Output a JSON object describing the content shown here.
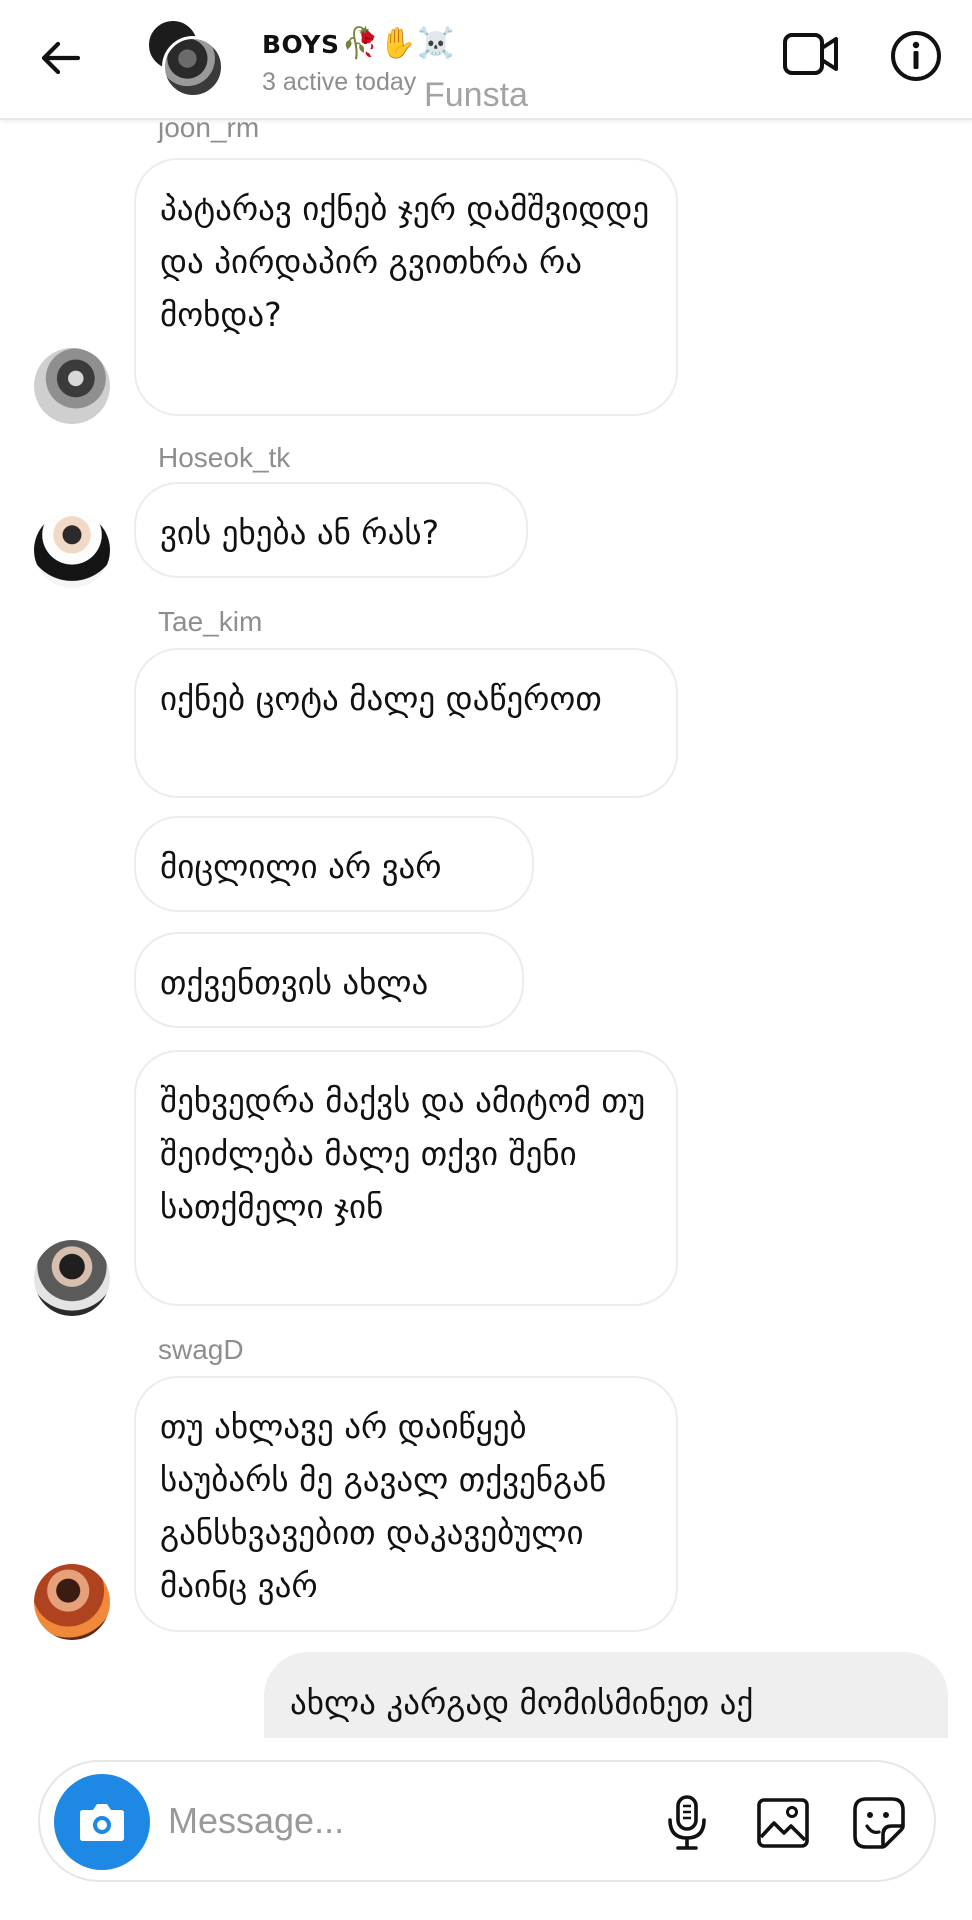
{
  "header": {
    "group_name": "BOYS",
    "group_emojis": "🥀✋☠️",
    "status": "3 active today",
    "watermark": "Funsta"
  },
  "messages": [
    {
      "sender": "joon_rm",
      "text": "პატარავ იქნებ ჯერ დამშვიდდე და პირდაპირ გვითხრა რა მოხდა?"
    },
    {
      "sender": "Hoseok_tk",
      "text": "ვის ეხება ან რას?"
    },
    {
      "sender": "Tae_kim",
      "text": "იქნებ ცოტა მალე დაწეროთ"
    },
    {
      "text": "მიცლილი არ ვარ"
    },
    {
      "text": "თქვენთვის ახლა"
    },
    {
      "text": "შეხვედრა მაქვს და ამიტომ თუ შეიძლება მალე თქვი შენი სათქმელი ჯინ"
    },
    {
      "sender": "swagD",
      "text": "თუ ახლავე არ დაიწყებ საუბარს მე გავალ თქვენგან განსხვავებით დაკავებული მაინც ვარ"
    },
    {
      "text": "ახლა კარგად მომისმინეთ აქ"
    }
  ],
  "composer": {
    "placeholder": "Message...",
    "value": ""
  },
  "colors": {
    "accent": "#1e88e5",
    "bubble_in_border": "#ececec",
    "bubble_out_bg": "#efefef",
    "muted_text": "#8e8e8e"
  },
  "icons": [
    "back-arrow-icon",
    "video-camera-icon",
    "info-icon",
    "camera-icon",
    "microphone-icon",
    "gallery-icon",
    "sticker-icon"
  ]
}
